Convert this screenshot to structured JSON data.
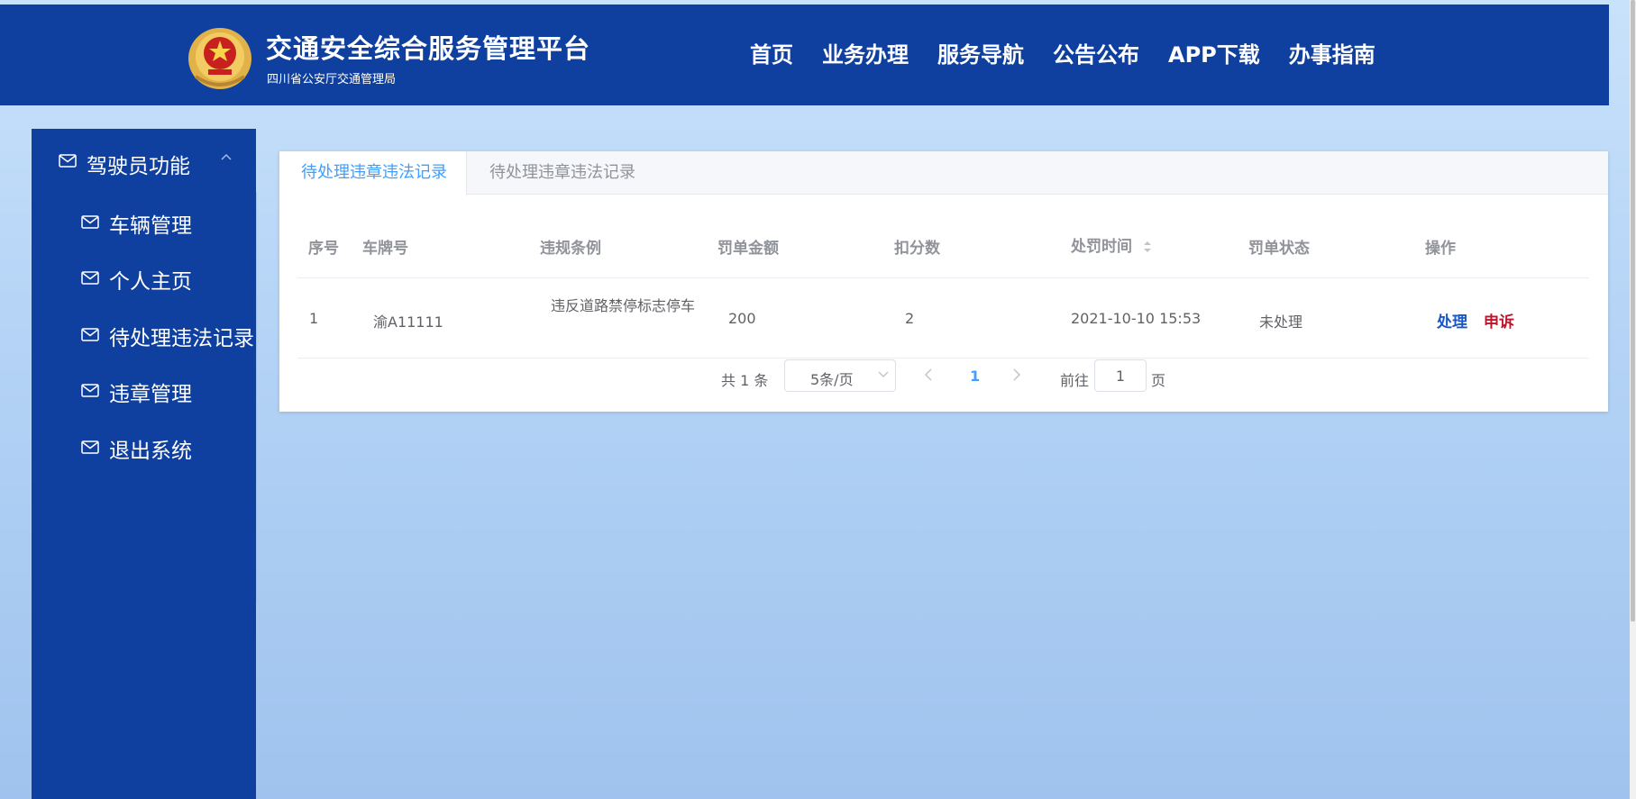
{
  "header": {
    "title": "交通安全综合服务管理平台",
    "subtitle": "四川省公安厅交通管理局",
    "nav": [
      "首页",
      "业务办理",
      "服务导航",
      "公告公布",
      "APP下载",
      "办事指南"
    ]
  },
  "sidebar": {
    "group_label": "驾驶员功能",
    "items": [
      {
        "label": "车辆管理",
        "icon": "mail-icon"
      },
      {
        "label": "个人主页",
        "icon": "mail-icon"
      },
      {
        "label": "待处理违法记录",
        "icon": "mail-icon"
      },
      {
        "label": "违章管理",
        "icon": "mail-icon"
      },
      {
        "label": "退出系统",
        "icon": "mail-icon"
      }
    ]
  },
  "tabs": [
    {
      "label": "待处理违章违法记录",
      "active": true
    },
    {
      "label": "待处理违章违法记录",
      "active": false
    }
  ],
  "table": {
    "columns": [
      "序号",
      "车牌号",
      "违规条例",
      "罚单金额",
      "扣分数",
      "处罚时间",
      "罚单状态",
      "操作"
    ],
    "rows": [
      {
        "index": "1",
        "plate": "渝A11111",
        "violation": "违反道路禁停标志停车",
        "fine": "200",
        "points": "2",
        "time": "2021-10-10 15:53",
        "status": "未处理",
        "actions": {
          "handle": "处理",
          "appeal": "申诉"
        }
      }
    ]
  },
  "pagination": {
    "total_text": "共 1 条",
    "page_size": "5条/页",
    "current_page": "1",
    "goto_label": "前往",
    "goto_value": "1",
    "page_suffix": "页"
  },
  "colors": {
    "primary_blue": "#0f40a0",
    "accent": "#409eff",
    "handle": "#1a56c4",
    "appeal": "#c0142b"
  }
}
